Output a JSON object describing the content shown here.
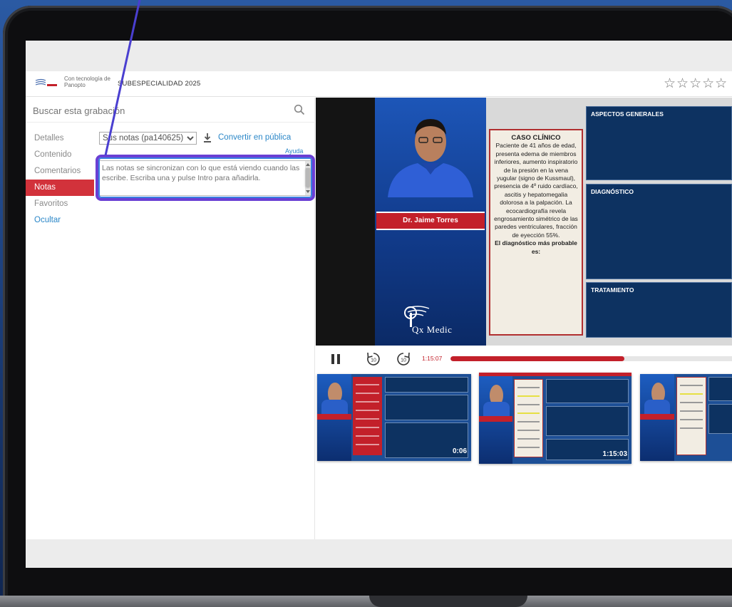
{
  "header": {
    "logo_text": "Con tecnología de Panopto",
    "course_title": "SUBESPECIALIDAD 2025",
    "rating_stars": "☆☆☆☆☆"
  },
  "search": {
    "placeholder": "Buscar esta grabación"
  },
  "sidebar": {
    "items": [
      {
        "label": "Detalles"
      },
      {
        "label": "Contenido"
      },
      {
        "label": "Comentarios"
      },
      {
        "label": "Notas"
      },
      {
        "label": "Favoritos"
      },
      {
        "label": "Ocultar"
      }
    ],
    "active": "Notas"
  },
  "notes": {
    "selected_option": "Sus notas (pa140625)",
    "make_public_label": "Convertir en pública",
    "help_label": "Ayuda",
    "placeholder": "Las notas se sincronizan con lo que está viendo cuando las escribe. Escriba una y pulse Intro para añadirla."
  },
  "video": {
    "presenter_name": "Dr. Jaime Torres",
    "brand": "Qx Medic",
    "case_title": "CASO CLÍNICO",
    "case_text": "Paciente de 41 años de edad, presenta edema de miembros inferiores, aumento inspiratorio de la presión en la vena yugular (signo de Kussmaul), presencia de 4º ruido cardíaco, ascitis y hepatomegalia dolorosa a la palpación. La ecocardiografía revela engrosamiento simétrico de las paredes ventriculares, fracción de eyección 55%.",
    "case_question": "El diagnóstico más probable es:",
    "boxes": [
      "ASPECTOS GENERALES",
      "DIAGNÓSTICO",
      "TRATAMIENTO"
    ]
  },
  "controls": {
    "current_time": "1:15:07",
    "progress_fraction": 0.61,
    "rewind_label": "10",
    "forward_label": "10"
  },
  "thumbnails": [
    {
      "duration": "0:06"
    },
    {
      "duration": "1:15:03"
    },
    {
      "duration": ""
    }
  ],
  "colors": {
    "accent_red": "#c3202a",
    "link_blue": "#2b87c8",
    "highlight_purple": "#6a3fd4",
    "dark_navy": "#0d3261"
  }
}
